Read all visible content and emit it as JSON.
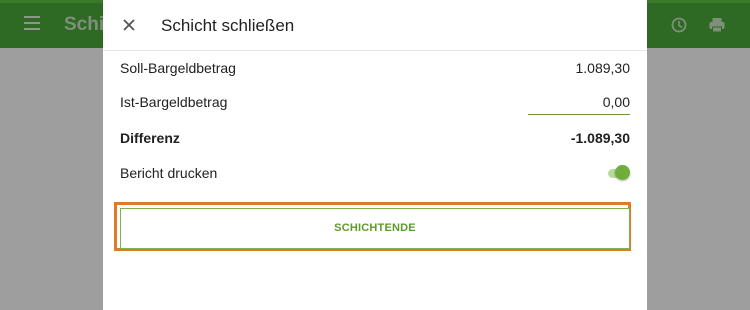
{
  "background": {
    "app_title": "Schic",
    "menu_icon": "menu-icon",
    "history_icon": "history-icon",
    "print_icon": "print-icon"
  },
  "dialog": {
    "close_icon": "close-icon",
    "title": "Schicht schließen",
    "rows": {
      "soll_label": "Soll-Bargeldbetrag",
      "soll_value": "1.089,30",
      "ist_label": "Ist-Bargeldbetrag",
      "ist_value": "0,00",
      "diff_label": "Differenz",
      "diff_value": "-1.089,30",
      "report_label": "Bericht drucken",
      "report_toggle_on": true
    },
    "end_button_label": "SCHICHTENDE"
  },
  "colors": {
    "appbar": "#2f6a24",
    "accent": "#6fae3a",
    "highlight": "#e07a26"
  }
}
